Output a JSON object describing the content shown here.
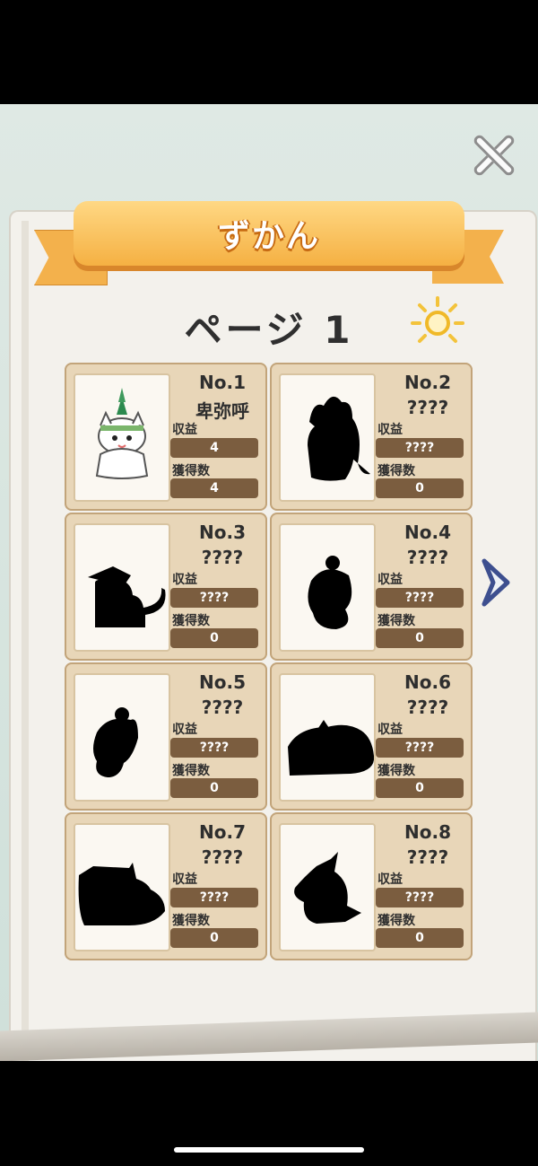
{
  "header": {
    "title": "ずかん",
    "page_label": "ページ 1"
  },
  "labels": {
    "income": "収益",
    "count": "獲得数"
  },
  "cards": [
    {
      "no": "No.1",
      "name": "卑弥呼",
      "income": "4",
      "count": "4",
      "unlocked": true
    },
    {
      "no": "No.2",
      "name": "????",
      "income": "????",
      "count": "0",
      "unlocked": false
    },
    {
      "no": "No.3",
      "name": "????",
      "income": "????",
      "count": "0",
      "unlocked": false
    },
    {
      "no": "No.4",
      "name": "????",
      "income": "????",
      "count": "0",
      "unlocked": false
    },
    {
      "no": "No.5",
      "name": "????",
      "income": "????",
      "count": "0",
      "unlocked": false
    },
    {
      "no": "No.6",
      "name": "????",
      "income": "????",
      "count": "0",
      "unlocked": false
    },
    {
      "no": "No.7",
      "name": "????",
      "income": "????",
      "count": "0",
      "unlocked": false
    },
    {
      "no": "No.8",
      "name": "????",
      "income": "????",
      "count": "0",
      "unlocked": false
    }
  ],
  "icons": {
    "close": "close-icon",
    "next": "chevron-right-icon",
    "decoration": "sun-icon"
  },
  "colors": {
    "ribbon": "#f4ad3d",
    "card_bg": "#e8d6b8",
    "value_bg": "#7b5d3f"
  }
}
